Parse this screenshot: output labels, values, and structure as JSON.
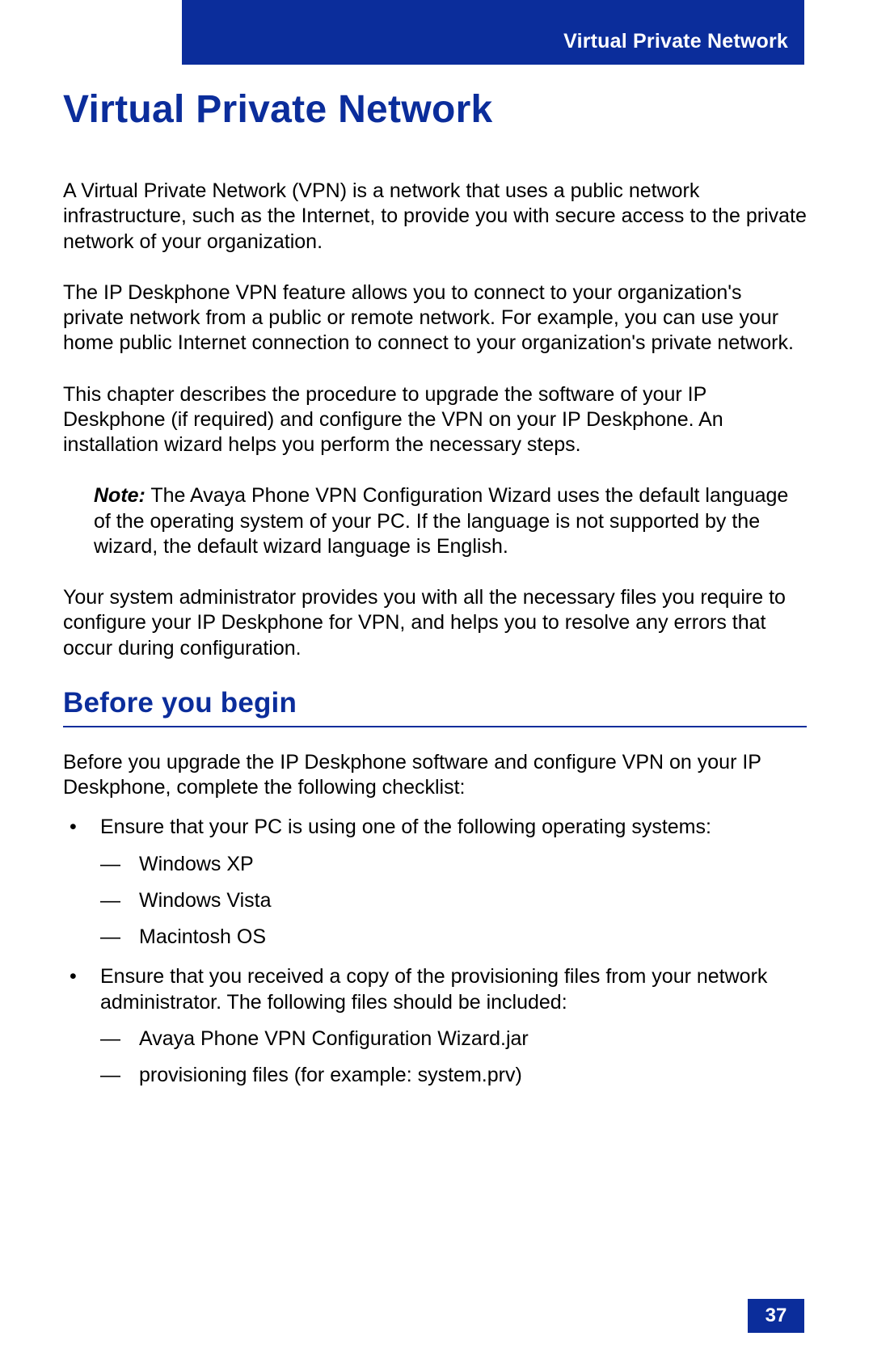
{
  "header": {
    "running_title": "Virtual Private Network"
  },
  "title": "Virtual Private Network",
  "paragraphs": {
    "p1": "A Virtual Private Network (VPN) is a network that uses a public network infrastructure, such as the Internet, to provide you with secure access to the private network of your organization.",
    "p2": "The IP Deskphone VPN feature allows you to connect to your organization's private network from a public or remote network. For example, you can use your home public Internet connection to connect to your organization's private network.",
    "p3": "This chapter describes the procedure to upgrade the software of your IP Deskphone (if required) and configure the VPN on your IP Deskphone. An installation wizard helps you perform the necessary steps.",
    "p4": "Your system administrator provides you with all the necessary files you require to configure your IP Deskphone for VPN, and helps you to resolve any errors that occur during configuration."
  },
  "note": {
    "label": "Note:",
    "text": " The Avaya Phone VPN Configuration Wizard uses the default language of the operating system of your PC. If the language is not supported by the wizard, the default wizard language is English."
  },
  "section": {
    "heading": "Before you begin",
    "intro": "Before you upgrade the IP Deskphone software and configure VPN on your IP Deskphone, complete the following checklist:",
    "bullets": [
      {
        "text": "Ensure that your PC is using one of the following operating systems:",
        "sub": [
          "Windows XP",
          "Windows Vista",
          "Macintosh OS"
        ]
      },
      {
        "text": "Ensure that you received a copy of the provisioning files from your network administrator. The following files should be included:",
        "sub": [
          "Avaya Phone VPN Configuration Wizard.jar",
          "provisioning files (for example: system.prv)"
        ]
      }
    ]
  },
  "page_number": "37",
  "colors": {
    "brand_blue": "#0b2d9b"
  }
}
